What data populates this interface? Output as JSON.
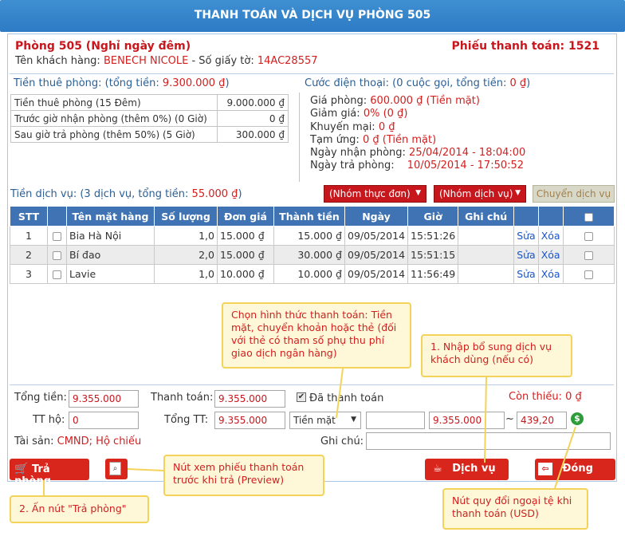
{
  "title": "THANH TOÁN VÀ DỊCH VỤ PHÒNG 505",
  "room": {
    "name": "Phòng 505 (Nghỉ ngày đêm)",
    "receipt": "Phiếu thanh toán: 1521",
    "customer_label": "Tên khách hàng:",
    "customer_name": "BENECH NICOLE",
    "id_label": "- Số giấy tờ:",
    "id_number": "14AC28557"
  },
  "room_fee": {
    "header_label": "Tiền thuê phòng: (tổng tiền:",
    "header_total": "9.300.000 ₫",
    "rows": [
      {
        "label": "Tiền thuê phòng (15 Đêm)",
        "value": "9.000.000 ₫"
      },
      {
        "label": "Trước giờ nhận phòng (thêm 0%) (0 Giờ)",
        "value": "0 ₫"
      },
      {
        "label": "Sau giờ trả phòng (thêm 50%) (5 Giờ)",
        "value": "300.000 ₫"
      }
    ]
  },
  "phone": {
    "header": "Cước điện thoại: (0 cuộc gọi, tổng tiền:",
    "total": "0 ₫"
  },
  "details": [
    {
      "label": "Giá phòng:",
      "value": "600.000 ₫ (Tiền mặt)"
    },
    {
      "label": "Giảm giá:",
      "value": "0% (0 ₫)"
    },
    {
      "label": "Khuyến mại:",
      "value": "0 ₫"
    },
    {
      "label": "Tạm ứng:",
      "value": "0 ₫ (Tiền mặt)"
    },
    {
      "label": "Ngày nhận phòng:",
      "value": "25/04/2014 - 18:04:00"
    },
    {
      "label": "Ngày trả phòng:",
      "value": "10/05/2014 - 17:50:52"
    }
  ],
  "services": {
    "header": "Tiền dịch vụ: (3 dịch vụ, tổng tiền:",
    "total": "55.000 ₫",
    "menu_group": "(Nhóm thực đơn)",
    "service_group": "(Nhóm dịch vụ)",
    "transfer_btn": "Chuyển dịch vụ",
    "columns": [
      "STT",
      "Tên mặt hàng",
      "Số lượng",
      "Đơn giá",
      "Thành tiền",
      "Ngày",
      "Giờ",
      "Ghi chú"
    ],
    "rows": [
      {
        "stt": "1",
        "name": "Bia Hà Nội",
        "qty": "1,0",
        "price": "15.000 ₫",
        "total": "15.000 ₫",
        "date": "09/05/2014",
        "time": "15:51:26",
        "note": "",
        "edit": "Sửa",
        "del": "Xóa"
      },
      {
        "stt": "2",
        "name": "Bí đao",
        "qty": "2,0",
        "price": "15.000 ₫",
        "total": "30.000 ₫",
        "date": "09/05/2014",
        "time": "15:51:15",
        "note": "",
        "edit": "Sửa",
        "del": "Xóa"
      },
      {
        "stt": "3",
        "name": "Lavie",
        "qty": "1,0",
        "price": "10.000 ₫",
        "total": "10.000 ₫",
        "date": "09/05/2014",
        "time": "11:56:49",
        "note": "",
        "edit": "Sửa",
        "del": "Xóa"
      }
    ]
  },
  "notes": {
    "payment_method": "Chọn hình thức thanh toán: Tiền mặt, chuyển khoản hoặc thẻ (đối với thẻ có tham số phụ thu phí giao dịch ngân hàng)",
    "add_service": "1. Nhập bổ sung dịch vụ khách dùng (nếu có)",
    "preview": "Nút xem phiếu thanh toán trước khi trả (Preview)",
    "checkout": "2. Ấn nút \"Trả phòng\"",
    "currency": "Nút quy đổi ngoại tệ khi thanh toán (USD)"
  },
  "summary": {
    "total_label": "Tổng tiền:",
    "total_value": "9.355.000",
    "paid_label": "Thanh toán:",
    "paid_value": "9.355.000",
    "paid_check_label": "Đã thanh toán",
    "remaining_label": "Còn thiếu:",
    "remaining_value": "0 ₫",
    "tt_ho_label": "TT hộ:",
    "tt_ho_value": "0",
    "grand_label": "Tổng TT:",
    "grand_value": "9.355.000",
    "method": "Tiền mặt",
    "extra_value": "",
    "amount_value": "9.355.000",
    "tilde": "~",
    "usd_value": "439,20",
    "assets_label": "Tài sản:",
    "assets_value": "CMND; Hộ chiếu",
    "remark_label": "Ghi chú:",
    "remark_value": ""
  },
  "buttons": {
    "checkout": "Trả phòng",
    "service": "Dịch vụ",
    "close": "Đóng"
  }
}
